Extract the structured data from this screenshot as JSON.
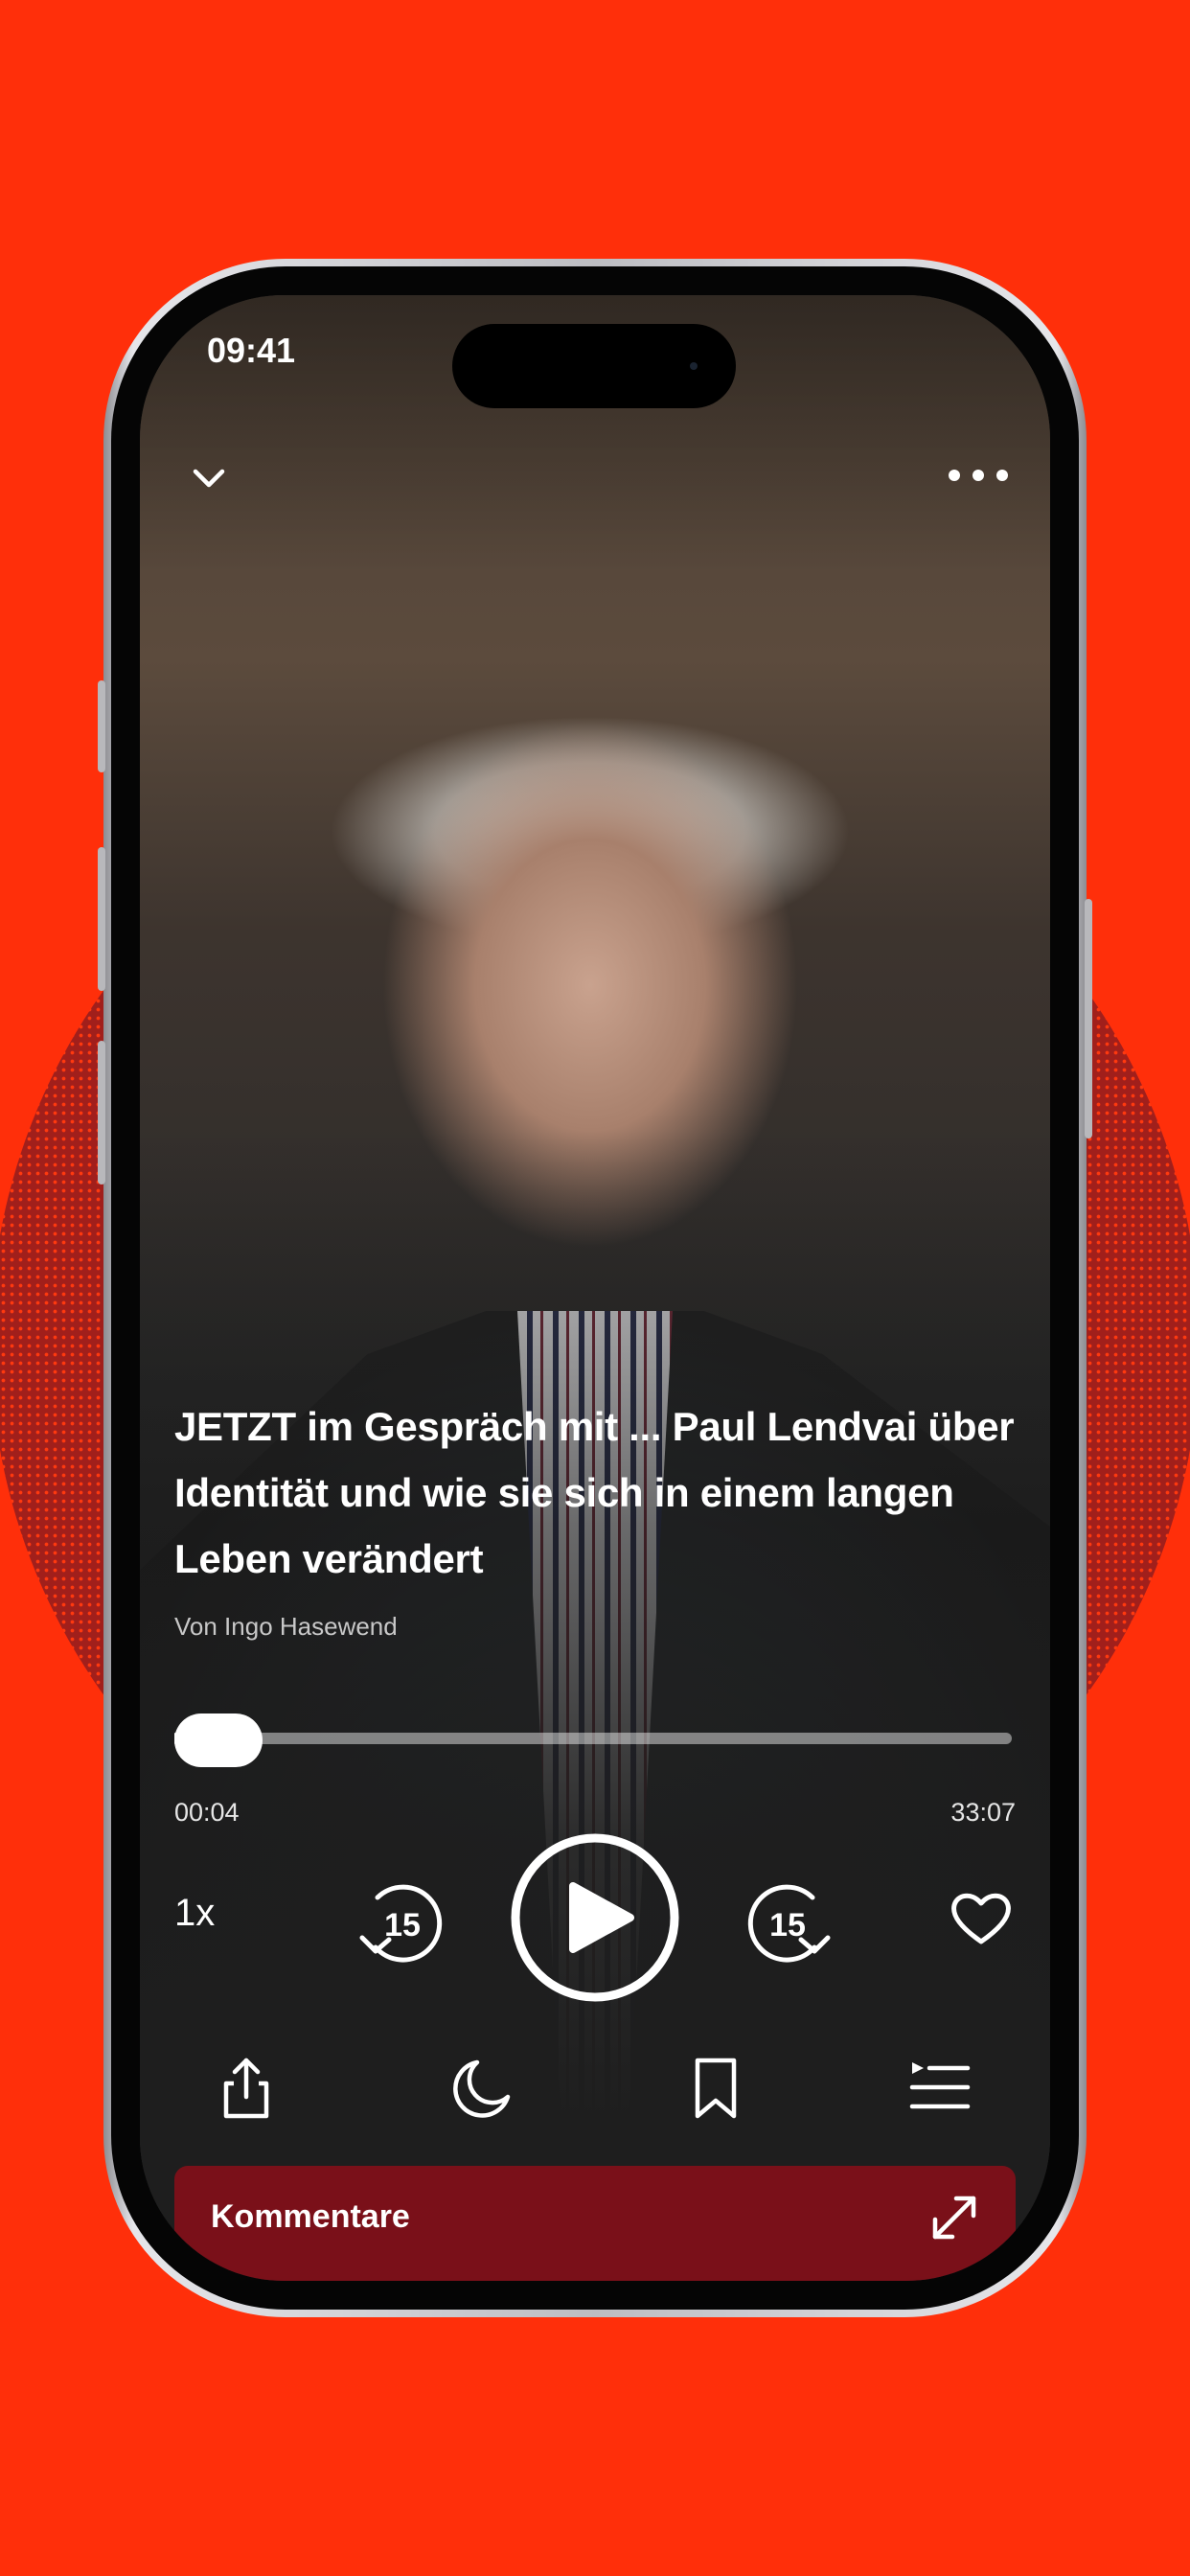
{
  "status_bar": {
    "time": "09:41"
  },
  "top_bar": {
    "collapse_icon": "chevron-down-icon",
    "menu_icon": "more-horizontal-icon"
  },
  "episode": {
    "title": "JETZT im Gespräch mit ...  Paul Lendvai über Identität und wie sie sich in einem langen Leben verändert",
    "author": "Von Ingo Hasewend"
  },
  "player": {
    "elapsed": "00:04",
    "total": "33:07",
    "progress_fraction": 0.002,
    "speed_label": "1x",
    "skip_back_seconds": "15",
    "skip_forward_seconds": "15",
    "state": "paused"
  },
  "actions": [
    "share-icon",
    "sleep-timer-moon-icon",
    "bookmark-icon",
    "queue-list-icon"
  ],
  "comments": {
    "label": "Kommentare",
    "expand_icon": "expand-icon"
  },
  "colors": {
    "background": "#ff2f0a",
    "comments_panel": "#7a1019",
    "dotted_circle": "#9c1f1c"
  }
}
